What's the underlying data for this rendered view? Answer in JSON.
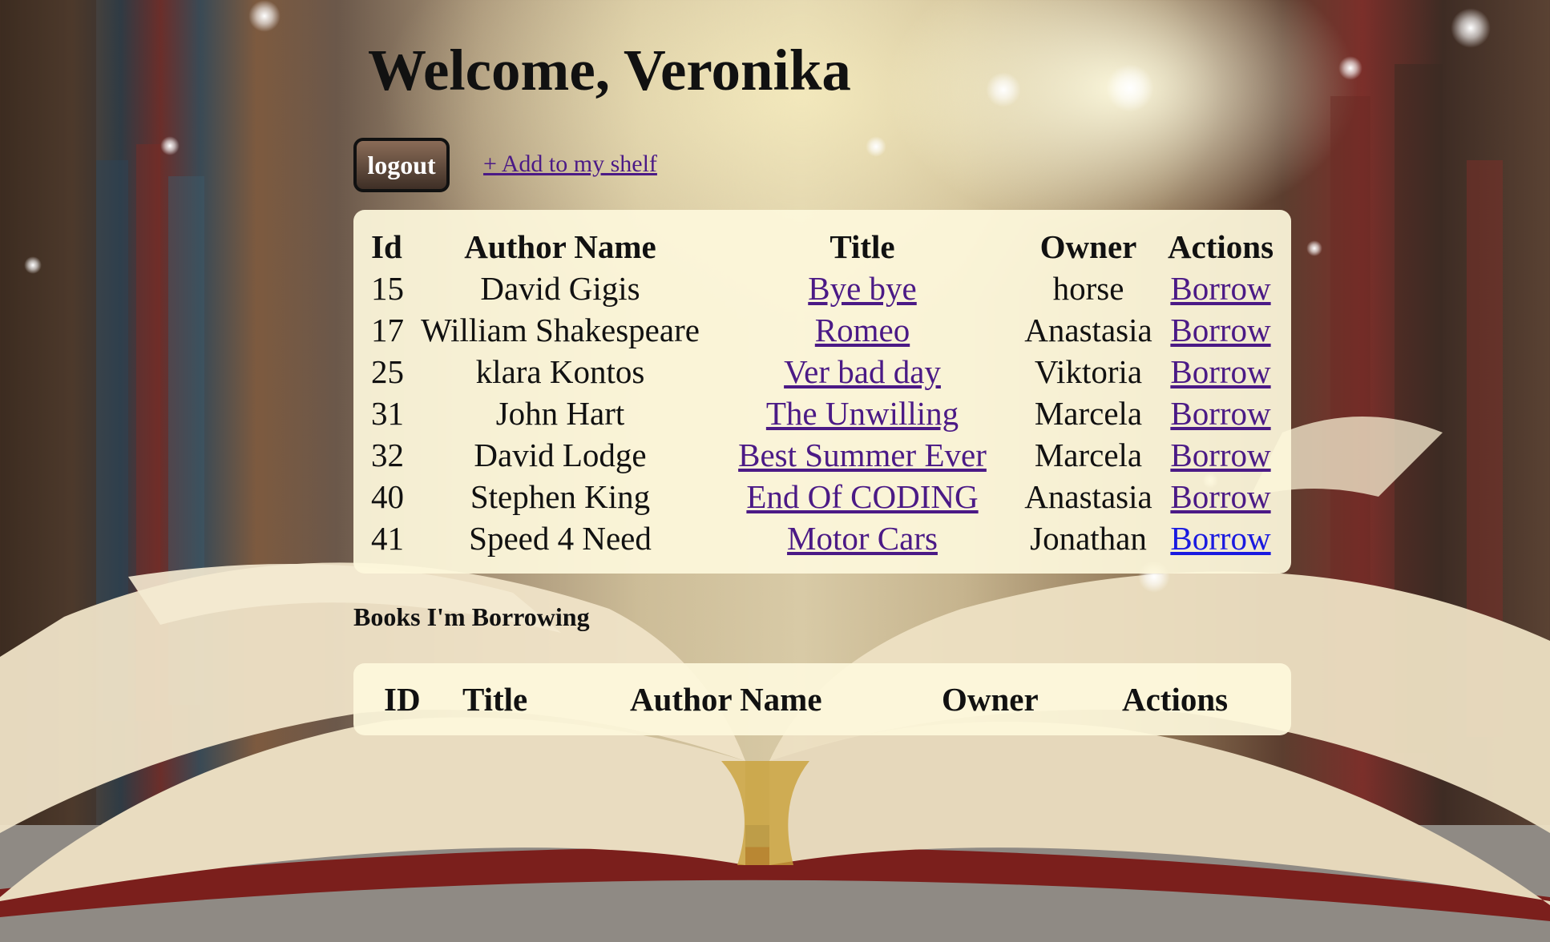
{
  "header": {
    "welcome": "Welcome, Veronika",
    "logout_label": "logout",
    "add_link_label": "+ Add to my shelf"
  },
  "books_table": {
    "headers": [
      "Id",
      "Author Name",
      "Title",
      "Owner",
      "Actions"
    ],
    "rows": [
      {
        "id": "15",
        "author": "David Gigis",
        "title": "Bye bye",
        "owner": "horse",
        "action": "Borrow"
      },
      {
        "id": "17",
        "author": "William Shakespeare",
        "title": "Romeo",
        "owner": "Anastasia",
        "action": "Borrow"
      },
      {
        "id": "25",
        "author": "klara Kontos",
        "title": "Ver bad day",
        "owner": "Viktoria",
        "action": "Borrow"
      },
      {
        "id": "31",
        "author": "John Hart",
        "title": "The Unwilling",
        "owner": "Marcela",
        "action": "Borrow"
      },
      {
        "id": "32",
        "author": "David Lodge",
        "title": "Best Summer Ever",
        "owner": "Marcela",
        "action": "Borrow"
      },
      {
        "id": "40",
        "author": "Stephen King",
        "title": "End Of CODING",
        "owner": "Anastasia",
        "action": "Borrow"
      },
      {
        "id": "41",
        "author": "Speed 4 Need",
        "title": "Motor Cars",
        "owner": "Jonathan",
        "action": "Borrow"
      }
    ]
  },
  "borrowing": {
    "section_title": "Books I'm Borrowing",
    "headers": [
      "ID",
      "Title",
      "Author Name",
      "Owner",
      "Actions"
    ]
  },
  "colors": {
    "visited_link": "#4b1a86",
    "active_link": "#1a1ae0",
    "panel_bg": "#fdf8dc"
  }
}
